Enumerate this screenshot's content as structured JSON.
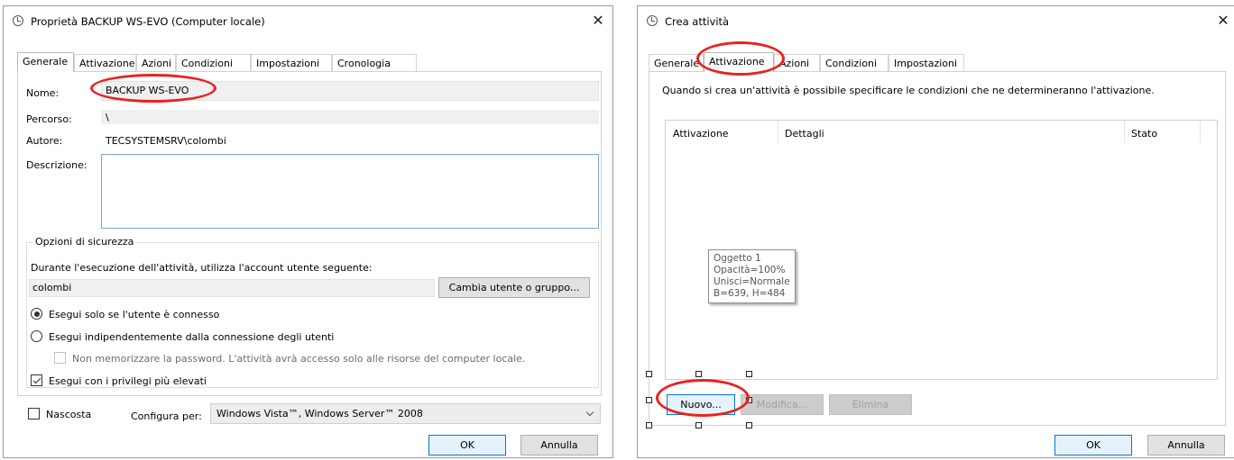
{
  "left_dialog": {
    "title": "Proprietà BACKUP WS-EVO (Computer locale)",
    "tabs": [
      "Generale",
      "Attivazione",
      "Azioni",
      "Condizioni",
      "Impostazioni",
      "Cronologia"
    ],
    "active_tab": "Generale",
    "fields": {
      "nome_label": "Nome:",
      "nome_value": "BACKUP WS-EVO",
      "percorso_label": "Percorso:",
      "percorso_value": "\\",
      "autore_label": "Autore:",
      "autore_value": "TECSYSTEMSRV\\colombi",
      "descrizione_label": "Descrizione:",
      "descrizione_value": ""
    },
    "security": {
      "legend": "Opzioni di sicurezza",
      "account_prompt": "Durante l'esecuzione dell'attività, utilizza l'account utente seguente:",
      "account_value": "colombi",
      "change_user_button": "Cambia utente o gruppo...",
      "radio_logged_on": "Esegui solo se l'utente è connesso",
      "radio_logged_on_selected": true,
      "radio_any": "Esegui indipendentemente dalla connessione degli utenti",
      "no_store_password": "Non memorizzare la password. L'attività avrà accesso solo alle risorse del computer locale.",
      "highest_privileges": "Esegui con i privilegi più elevati",
      "highest_privileges_checked": true
    },
    "hidden_label": "Nascosta",
    "hidden_checked": false,
    "configure_label": "Configura per:",
    "configure_value": "Windows Vista™, Windows Server™ 2008",
    "ok_button": "OK",
    "cancel_button": "Annulla",
    "close_glyph": "✕"
  },
  "right_dialog": {
    "title": "Crea attività",
    "tabs": [
      "Generale",
      "Attivazione",
      "Azioni",
      "Condizioni",
      "Impostazioni"
    ],
    "active_tab": "Attivazione",
    "description": "Quando si crea un'attività è possibile specificare le condizioni che ne determineranno l'attivazione.",
    "columns": [
      "Attivazione",
      "Dettagli",
      "Stato"
    ],
    "tooltip_lines": [
      "Oggetto 1",
      "Opacità=100%",
      "Unisci=Normale",
      "B=639, H=484"
    ],
    "new_button": "Nuovo...",
    "edit_button": "Modifica...",
    "delete_button": "Elimina",
    "ok_button": "OK",
    "cancel_button": "Annulla",
    "close_glyph": "✕"
  },
  "annotation_color": "#e8231f"
}
